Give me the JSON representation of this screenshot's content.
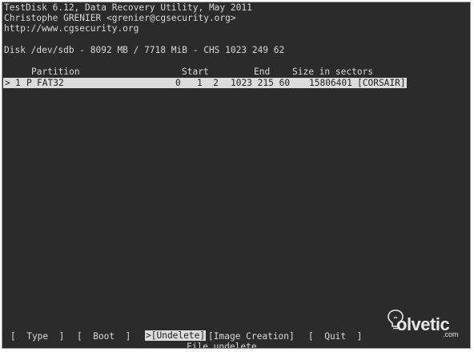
{
  "header": {
    "line1": "TestDisk 6.12, Data Recovery Utility, May 2011",
    "line2": "Christophe GRENIER <grenier@cgsecurity.org>",
    "line3": "http://www.cgsecurity.org"
  },
  "disk_info": "Disk /dev/sdb - 8092 MB / 7718 MiB - CHS 1023 249 62",
  "table": {
    "headers": {
      "partition": "Partition",
      "start": "Start",
      "end": "End",
      "size": "Size in sectors"
    },
    "rows": [
      {
        "cursor": ">",
        "number": "1",
        "flag": "P",
        "type": "FAT32",
        "start": "0   1  2",
        "end": "1023 215 60",
        "size": "15806401",
        "label": "[CORSAIR]"
      }
    ]
  },
  "menu": {
    "type": "[  Type  ]",
    "boot": "[  Boot  ]",
    "undelete": ">[Undelete]",
    "image_creation": "[Image Creation]",
    "quit": "[  Quit  ]",
    "hint": "File undelete"
  },
  "watermark": {
    "brand": "olvetic",
    "suffix": ".com"
  }
}
